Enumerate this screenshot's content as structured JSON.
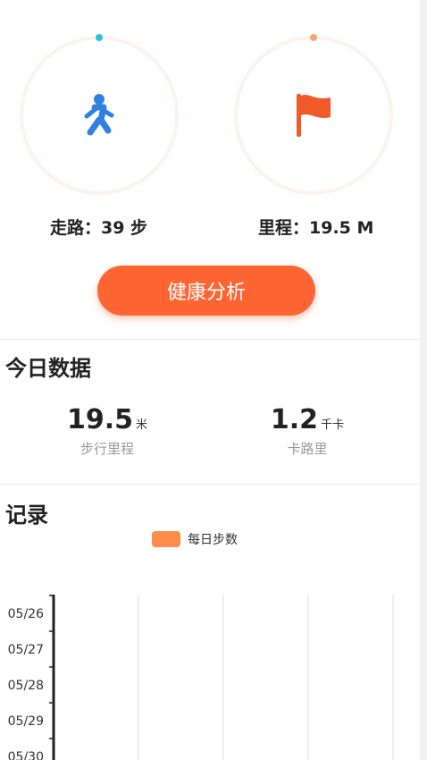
{
  "stats": {
    "walk_label": "走路：39 步",
    "distance_label": "里程：19.5 M",
    "walk_dot_color": "#26c6e3",
    "distance_dot_color": "#ffa26b",
    "walk_icon": "walking-person-icon",
    "distance_icon": "flag-icon"
  },
  "analysis_button_label": "健康分析",
  "today": {
    "title": "今日数据",
    "distance": {
      "value": "19.5",
      "unit": "米",
      "label": "步行里程"
    },
    "calories": {
      "value": "1.2",
      "unit": "千卡",
      "label": "卡路里"
    }
  },
  "records": {
    "title": "记录",
    "legend": "每日步数",
    "accent_color": "#ff8c4b"
  },
  "chart_data": {
    "type": "bar",
    "orientation": "horizontal",
    "categories": [
      "05/26",
      "05/27",
      "05/28",
      "05/29",
      "05/30"
    ],
    "series": [
      {
        "name": "每日步数",
        "values": [
          0,
          0,
          0,
          0,
          0
        ]
      }
    ],
    "grid": true,
    "legend_position": "top-center"
  }
}
